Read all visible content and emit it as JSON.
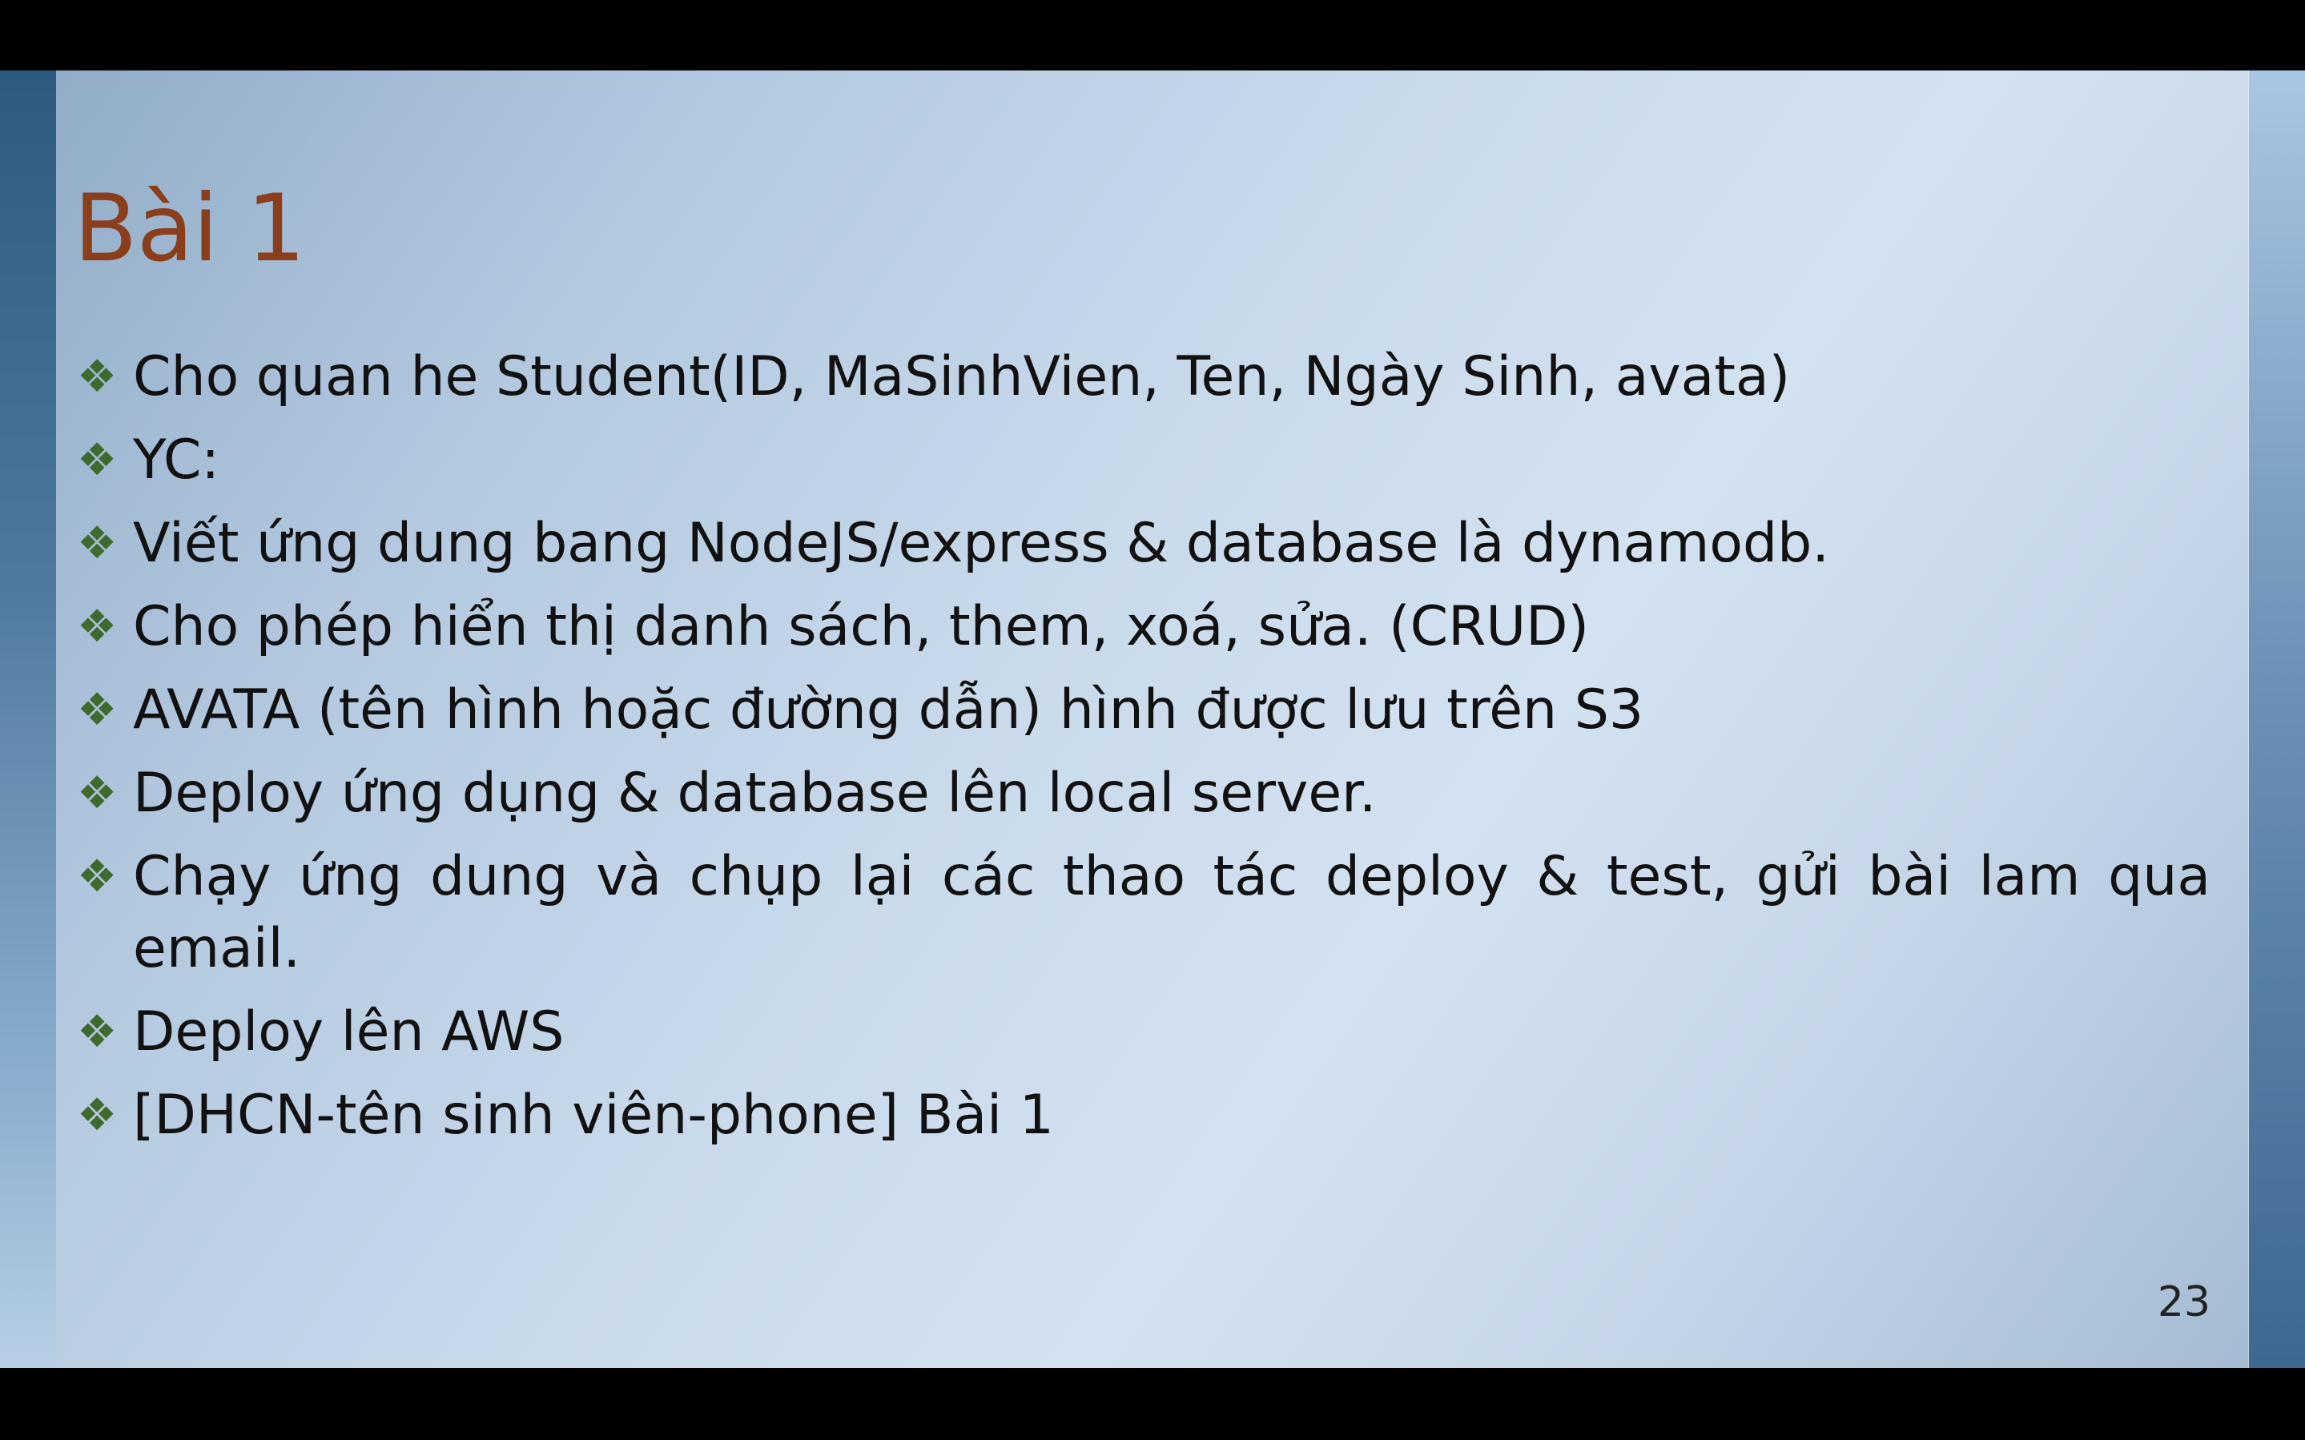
{
  "slide": {
    "title": "Bài 1",
    "page_number": "23",
    "bullets": [
      {
        "text": "Cho quan he Student(ID, MaSinhVien, Ten, Ngày Sinh, avata)"
      },
      {
        "text": "YC:"
      },
      {
        "text": "Viết ứng dung bang NodeJS/express & database là dynamodb."
      },
      {
        "text": "Cho phép hiển thị danh sách, them, xoá, sửa. (CRUD)"
      },
      {
        "text": "AVATA (tên hình hoặc đường dẫn) hình được lưu trên S3"
      },
      {
        "text": "Deploy ứng dụng & database lên local server."
      },
      {
        "text": "Chạy ứng dung và chụp lại các thao tác deploy & test, gửi bài lam qua email."
      },
      {
        "text": "Deploy lên AWS"
      },
      {
        "text": "[DHCN-tên sinh viên-phone] Bài 1"
      }
    ],
    "bullet_glyph": "❖",
    "colors": {
      "title": "#8a3e1c",
      "bullet": "#3f6a2e",
      "text": "#111111"
    }
  },
  "toolbar": {
    "icons": [
      "arrow-left-icon",
      "pen-icon",
      "slides-icon",
      "more-icon",
      "arrow-right-icon"
    ]
  }
}
